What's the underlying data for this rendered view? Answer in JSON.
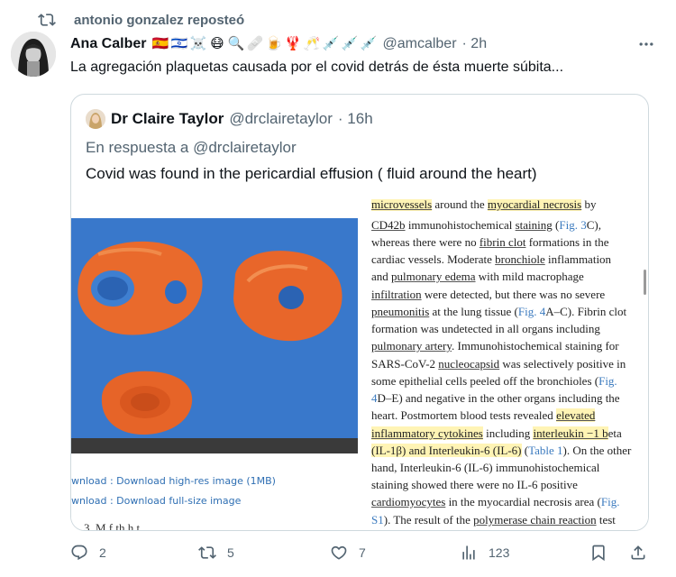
{
  "repost": {
    "text": "antonio gonzalez reposteó",
    "icon": "repost-icon"
  },
  "tweet": {
    "author_name": "Ana Calber",
    "emojis": [
      "🇪🇸",
      "🇮🇱",
      "☠️",
      "😷",
      "🔍",
      "🩹",
      "🍺",
      "🦞",
      "🥂",
      "💉",
      "💉",
      "💉"
    ],
    "handle": "@amcalber",
    "time": "· 2h",
    "text": "La agregación plaquetas causada por el covid detrás de ésta muerte súbita..."
  },
  "quote": {
    "author_name": "Dr Claire Taylor",
    "handle": "@drclairetaylor",
    "time": "· 16h",
    "reply_prefix": "En respuesta a",
    "reply_mention": "@drclairetaylor",
    "text": "Covid was found in the pericardial effusion ( fluid around the heart)",
    "media": {
      "download_1": "wnload : Download high-res image (1MB)",
      "download_2": "wnload : Download full-size image",
      "cut_caption": "3. M                    f th     h   t"
    }
  },
  "actions": {
    "reply_count": "2",
    "repost_count": "5",
    "like_count": "7",
    "views_count": "123"
  },
  "colors": {
    "text_primary": "#0f1419",
    "text_secondary": "#536471",
    "border": "#cfd9de",
    "paper_link": "#3c7bbf"
  }
}
